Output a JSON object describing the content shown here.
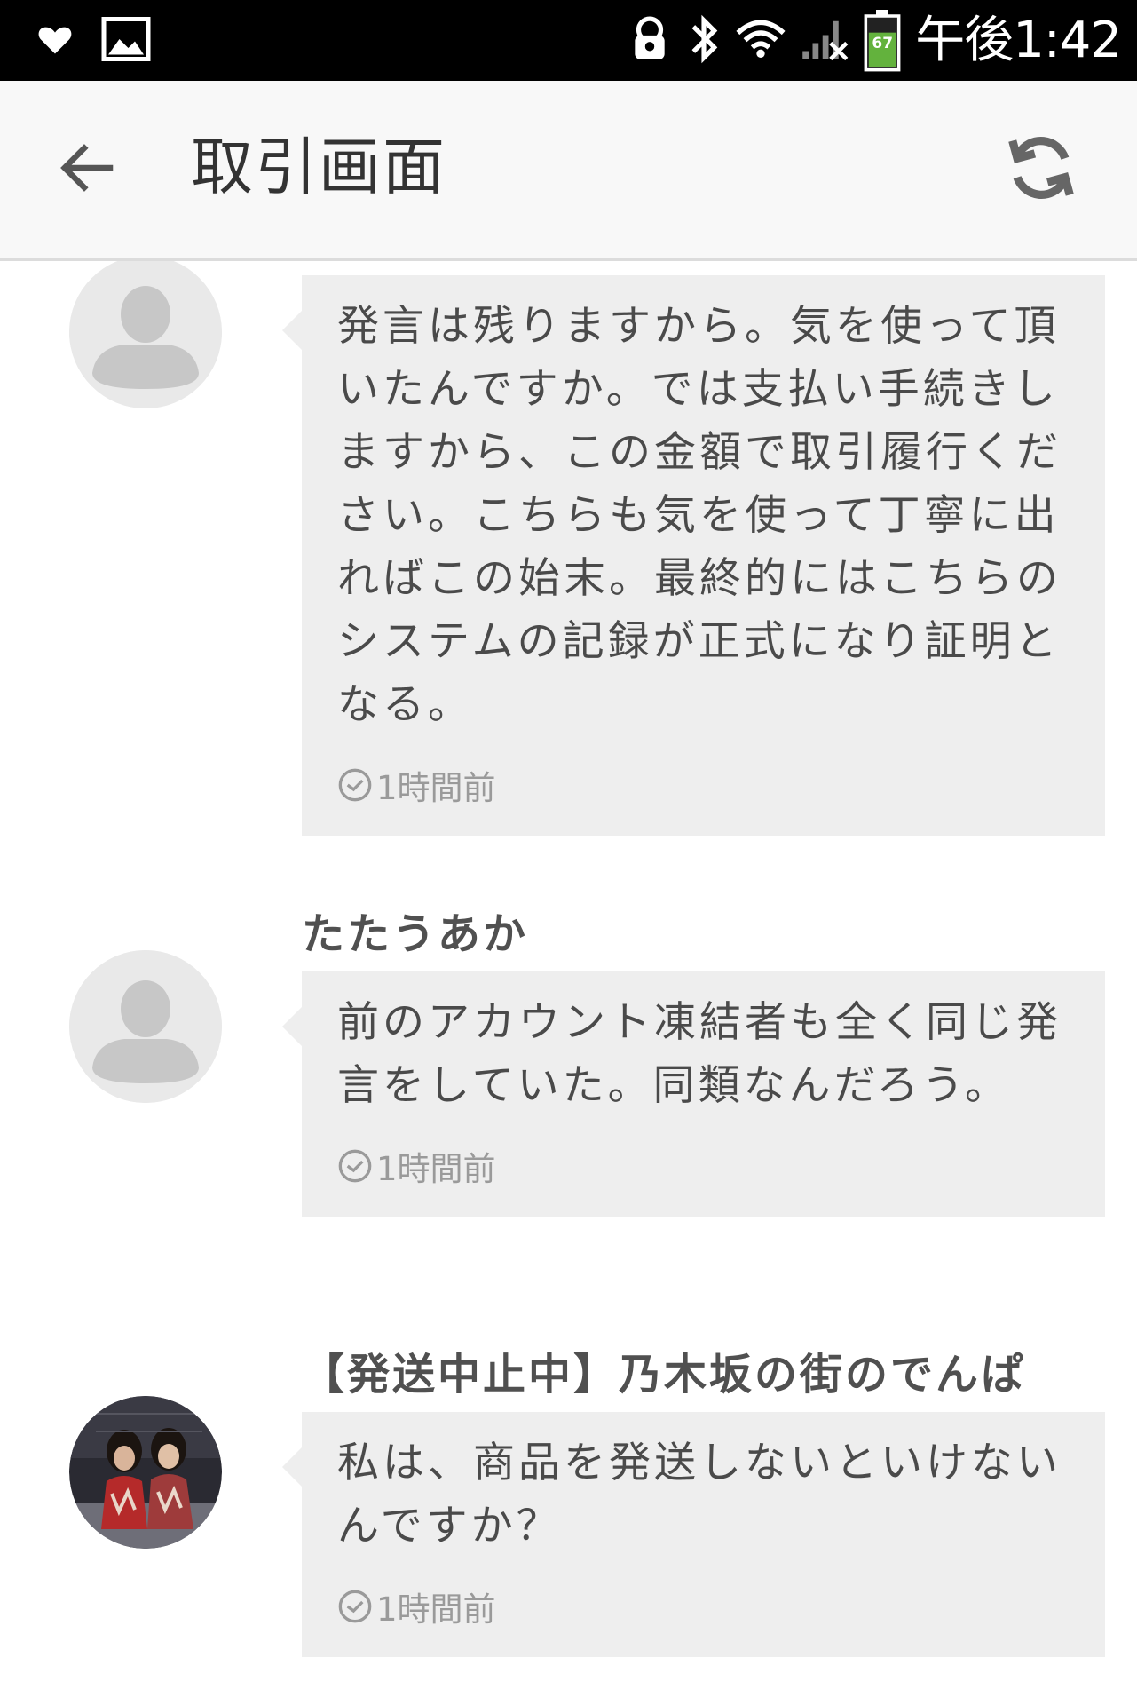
{
  "status_bar": {
    "time": "午後1:42",
    "battery_level": "67",
    "icons": [
      "heart-icon",
      "image-icon",
      "lock-icon",
      "bluetooth-icon",
      "wifi-icon",
      "signal-icon",
      "battery-icon"
    ]
  },
  "app_bar": {
    "title": "取引画面",
    "back_icon": "arrow-left-icon",
    "refresh_icon": "refresh-icon"
  },
  "messages": [
    {
      "sender": "",
      "avatar": "default-avatar",
      "text": "発言は残りますから。気を使って頂いたんですか。では支払い手続きしますから、この金額で取引履行ください。こちらも気を使って丁寧に出ればこの始末。最終的にはこちらのシステムの記録が正式になり証明となる。",
      "time": "1時間前"
    },
    {
      "sender": "たたうあか",
      "avatar": "default-avatar",
      "text": "前のアカウント凍結者も全く同じ発言をしていた。同類なんだろう。",
      "time": "1時間前"
    },
    {
      "sender": "【発送中止中】乃木坂の街のでんぱ",
      "avatar": "photo-avatar",
      "text": "私は、商品を発送しないといけないんですか？",
      "time": "1時間前"
    }
  ],
  "colors": {
    "status_bar_bg": "#000000",
    "app_bar_bg": "#f8f8f8",
    "bubble_bg": "#eeeeee",
    "text": "#4a4a4a",
    "timestamp": "#9a9a9a"
  }
}
